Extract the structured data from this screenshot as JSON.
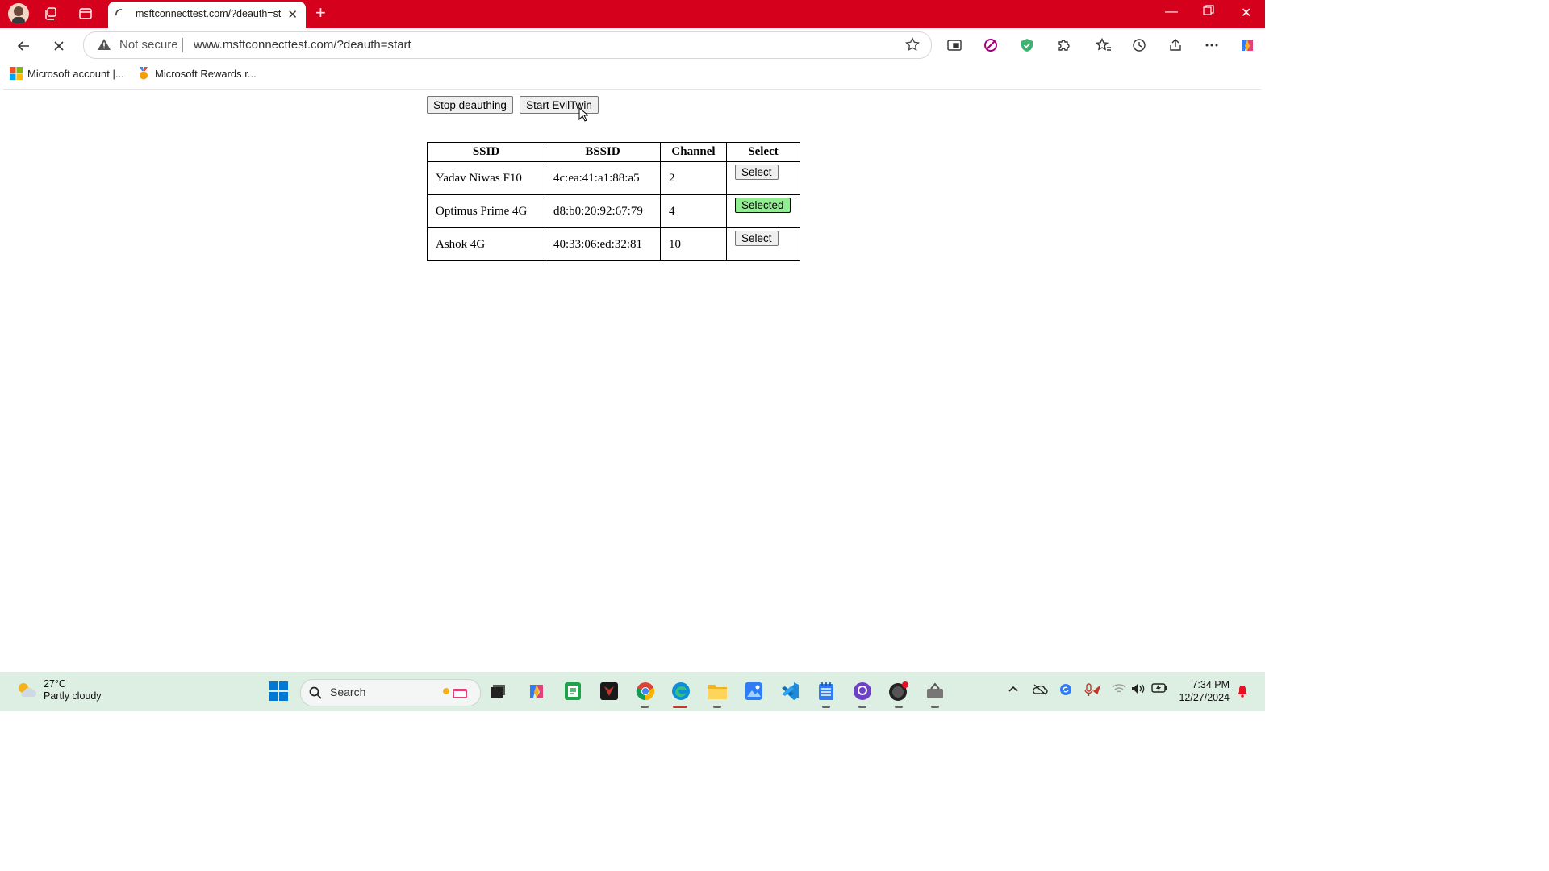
{
  "browser": {
    "tab_title": "msftconnecttest.com/?deauth=st",
    "address_warning": "Not secure",
    "url": "www.msftconnecttest.com/?deauth=start",
    "bookmarks": [
      {
        "label": "Microsoft account |..."
      },
      {
        "label": "Microsoft Rewards r..."
      }
    ]
  },
  "page": {
    "stop_button": "Stop deauthing",
    "eviltwin_button": "Start EvilTwin",
    "table": {
      "headers": [
        "SSID",
        "BSSID",
        "Channel",
        "Select"
      ],
      "rows": [
        {
          "ssid": "Yadav Niwas F10",
          "bssid": "4c:ea:41:a1:88:a5",
          "channel": "2",
          "action": "Select",
          "selected": false
        },
        {
          "ssid": "Optimus Prime 4G",
          "bssid": "d8:b0:20:92:67:79",
          "channel": "4",
          "action": "Selected",
          "selected": true
        },
        {
          "ssid": "Ashok 4G",
          "bssid": "40:33:06:ed:32:81",
          "channel": "10",
          "action": "Select",
          "selected": false
        }
      ]
    }
  },
  "taskbar": {
    "weather_temp": "27°C",
    "weather_desc": "Partly cloudy",
    "search_placeholder": "Search",
    "time": "7:34 PM",
    "date": "12/27/2024"
  },
  "colors": {
    "titlebar": "#d5001c",
    "selected_button": "#90ee90"
  }
}
